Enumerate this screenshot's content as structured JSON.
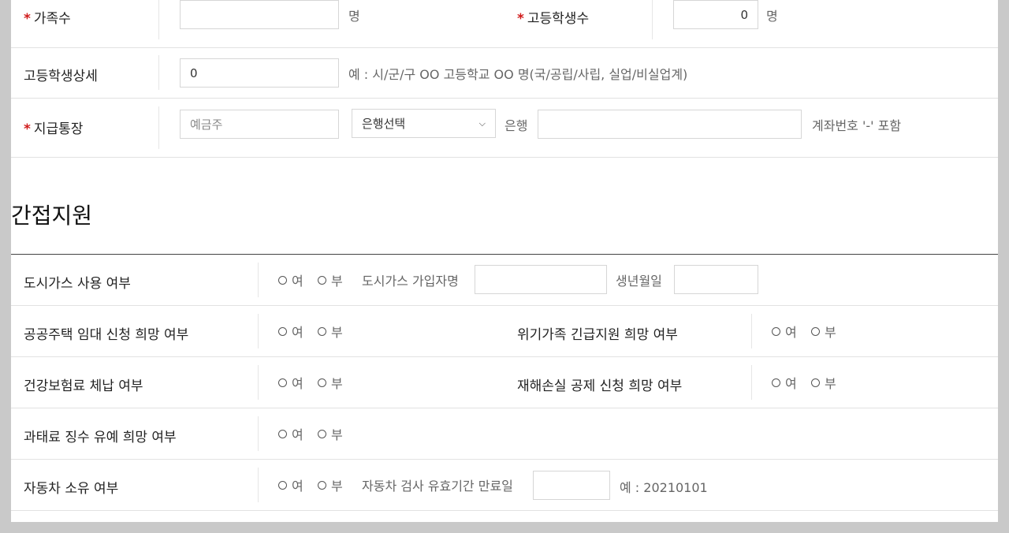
{
  "top_form": {
    "family_count": {
      "label": "가족수",
      "value": "",
      "unit": "명"
    },
    "high_student_count": {
      "label": "고등학생수",
      "value": "0",
      "unit": "명"
    },
    "high_student_detail": {
      "label": "고등학생상세",
      "value": "0",
      "hint": "예 : 시/군/구 OO 고등학교 OO 명(국/공립/사립, 실업/비실업계)"
    },
    "payment_account": {
      "label": "지급통장",
      "holder_placeholder": "예금주",
      "bank_select": "은행선택",
      "bank_suffix": "은행",
      "account_value": "",
      "hint": "계좌번호 '-' 포함"
    }
  },
  "section": {
    "title": "간접지원"
  },
  "radio_options": {
    "yes": "여",
    "no": "부"
  },
  "indirect_rows": {
    "city_gas": {
      "label": "도시가스 사용 여부",
      "subscriber_label": "도시가스 가입자명",
      "birth_label": "생년월일"
    },
    "public_housing": {
      "label": "공공주택 임대 신청 희망 여부"
    },
    "crisis_family": {
      "label": "위기가족 긴급지원 희망 여부"
    },
    "health_insurance": {
      "label": "건강보험료 체납 여부"
    },
    "disaster_loss": {
      "label": "재해손실 공제 신청 희망 여부"
    },
    "fine_deferral": {
      "label": "과태료 징수 유예 희망 여부"
    },
    "car": {
      "label": "자동차 소유 여부",
      "inspection_label": "자동차 검사 유효기간 만료일",
      "example": "예 : 20210101"
    }
  }
}
